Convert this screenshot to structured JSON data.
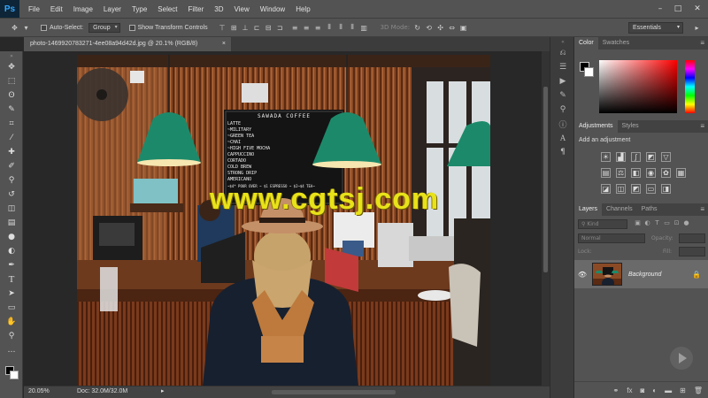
{
  "app": {
    "logo": "Ps"
  },
  "menu": [
    "File",
    "Edit",
    "Image",
    "Layer",
    "Type",
    "Select",
    "Filter",
    "3D",
    "View",
    "Window",
    "Help"
  ],
  "window_controls": [
    "–",
    "□",
    "✕"
  ],
  "options_bar": {
    "auto_select_label": "Auto-Select:",
    "auto_select_value": "Group",
    "show_transform_label": "Show Transform Controls",
    "mode_3d_label": "3D Mode:",
    "workspace": "Essentials"
  },
  "document": {
    "tab_title": "photo-1469920783271-4ee08a94d42d.jpg @ 20.1% (RGB/8)",
    "close": "×",
    "zoom": "20.05%",
    "doc_info": "Doc: 32.0M/32.0M",
    "watermark": "www.cgtsj.com"
  },
  "photo_menu_board": {
    "title": "SAWADA  COFFEE",
    "lines": [
      "LATTE",
      "~MILITARY",
      "~GREEN TEA",
      "~CHAI",
      "~HIGH FIVE MOCHA",
      "CAPPUCCINO",
      "CORTADO",
      "COLD BREW",
      "STRONG DRIP",
      "AMERICANO",
      "~$4* POUR OVER ~ $1 ESPRESSO ~ $2~$4 TEA~"
    ]
  },
  "color_panel": {
    "tabs": [
      "Color",
      "Swatches"
    ]
  },
  "adjustments_panel": {
    "tabs": [
      "Adjustments",
      "Styles"
    ],
    "add_label": "Add an adjustment"
  },
  "layers_panel": {
    "tabs": [
      "Layers",
      "Channels",
      "Paths"
    ],
    "filter_kind": "Kind",
    "blend_mode": "Normal",
    "opacity_label": "Opacity:",
    "lock_label": "Lock:",
    "fill_label": "Fill:",
    "layer_name": "Background",
    "footer_fx": "fx"
  },
  "colors": {
    "accent": "#31a8ff",
    "panel": "#535353",
    "watermark": "#e8e21a"
  }
}
